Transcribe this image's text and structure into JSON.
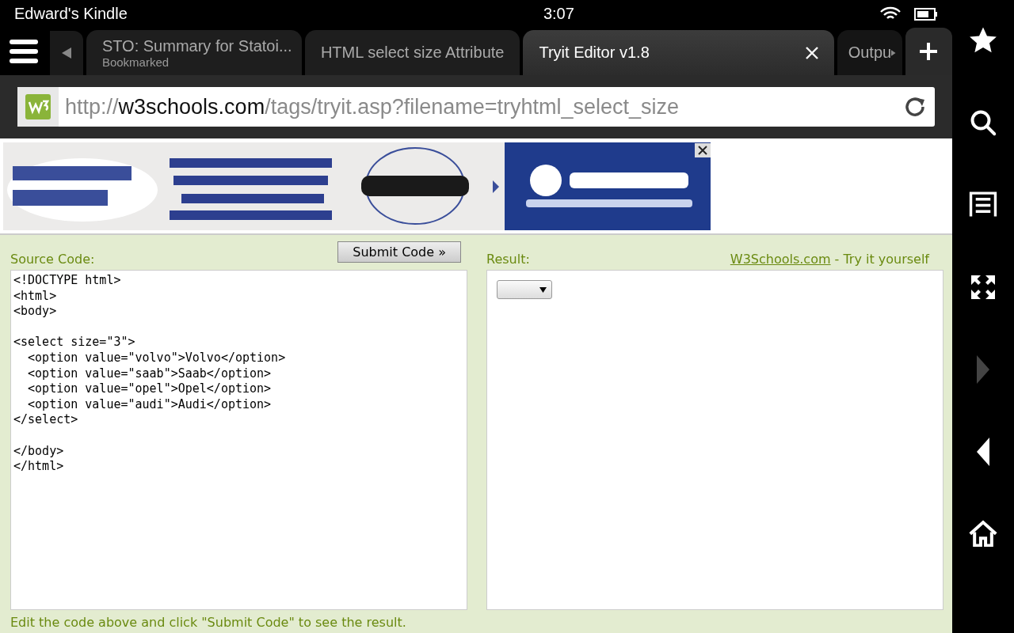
{
  "status_bar": {
    "device_name": "Edward's Kindle",
    "time": "3:07"
  },
  "tabs": [
    {
      "title": "STO: Summary for Statoi...",
      "subtitle": "Bookmarked",
      "selected": false
    },
    {
      "title": "HTML select size Attribute",
      "selected": false
    },
    {
      "title": "Tryit Editor v1.8",
      "selected": true
    },
    {
      "title": "Outpu",
      "selected": false
    }
  ],
  "address_bar": {
    "url_prefix": "http://",
    "url_domain": "w3schools.com",
    "url_path": "/tags/tryit.asp?filename=tryhtml_select_size"
  },
  "editor": {
    "source_label": "Source Code:",
    "submit_button": "Submit Code »",
    "code": "<!DOCTYPE html>\n<html>\n<body>\n\n<select size=\"3\">\n  <option value=\"volvo\">Volvo</option>\n  <option value=\"saab\">Saab</option>\n  <option value=\"opel\">Opel</option>\n  <option value=\"audi\">Audi</option>\n</select>\n\n</body>\n</html>",
    "result_label": "Result:",
    "site_link": "W3Schools.com",
    "site_tagline": "- Try it yourself",
    "hint": "Edit the code above and click \"Submit Code\" to see the result."
  },
  "side_nav": [
    {
      "kind": "favorites",
      "disabled": false
    },
    {
      "kind": "search",
      "disabled": false
    },
    {
      "kind": "reading_view",
      "disabled": false
    },
    {
      "kind": "fullscreen",
      "disabled": false
    },
    {
      "kind": "forward",
      "disabled": true
    },
    {
      "kind": "back",
      "disabled": false
    },
    {
      "kind": "home",
      "disabled": false
    }
  ]
}
